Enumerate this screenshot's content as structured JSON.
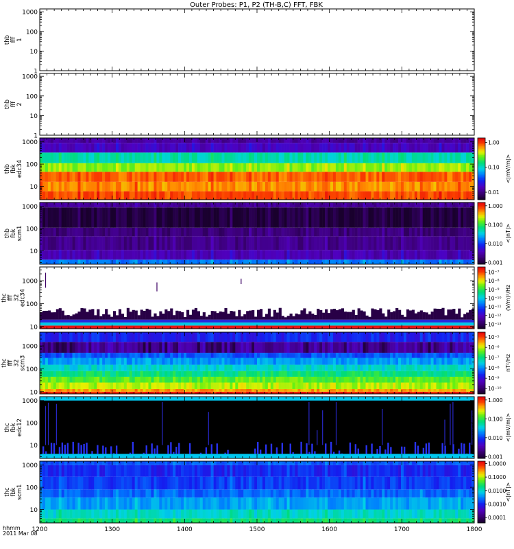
{
  "chart_data": {
    "type": "heatmap",
    "title": "Outer Probes: P1, P2 (TH-B,C) FFT, FBK",
    "x_axis": {
      "label_line1": "hhmm",
      "label_line2": "2011 Mar 08",
      "range": [
        1200,
        1800
      ],
      "tick_labels": [
        "1200",
        "1300",
        "1400",
        "1500",
        "1600",
        "1700",
        "1800"
      ],
      "tick_values": [
        1200,
        1300,
        1400,
        1500,
        1600,
        1700,
        1800
      ]
    },
    "panels": [
      {
        "ylabel": [
          "thb",
          "fff",
          "1"
        ],
        "ylog": true,
        "yrange": [
          1,
          1400
        ],
        "y_tick_labels": [
          "1",
          "10",
          "100",
          "1000"
        ],
        "y_tick_values": [
          1,
          10,
          100,
          1000
        ],
        "colorbar": null,
        "pattern": "empty"
      },
      {
        "ylabel": [
          "thb",
          "fff",
          "2"
        ],
        "ylog": true,
        "yrange": [
          1,
          1400
        ],
        "y_tick_labels": [
          "1",
          "10",
          "100",
          "1000"
        ],
        "y_tick_values": [
          1,
          10,
          100,
          1000
        ],
        "colorbar": null,
        "pattern": "empty"
      },
      {
        "ylabel": [
          "thb",
          "fbk",
          "edc34"
        ],
        "ylog": true,
        "yrange": [
          2.5,
          1500
        ],
        "y_tick_labels": [
          "10",
          "100",
          "1000"
        ],
        "y_tick_values": [
          10,
          100,
          1000
        ],
        "colorbar": {
          "label": "<|mV/m|>",
          "ticks": [
            "1.00",
            "0.10",
            "0.01"
          ],
          "tick_values": [
            1.0,
            0.1,
            0.01
          ],
          "range": [
            0.005,
            1.5
          ],
          "log": true
        },
        "pattern": "bands",
        "bands": [
          {
            "f": [
              2.5,
              6
            ],
            "level": 0.92
          },
          {
            "f": [
              6,
              16
            ],
            "level": 0.86
          },
          {
            "f": [
              16,
              45
            ],
            "level": 0.9
          },
          {
            "f": [
              45,
              110
            ],
            "level": 0.72
          },
          {
            "f": [
              110,
              330
            ],
            "level": 0.55
          },
          {
            "f": [
              330,
              900
            ],
            "level": 0.2
          },
          {
            "f": [
              900,
              1500
            ],
            "level": 0.15
          }
        ]
      },
      {
        "ylabel": [
          "thb",
          "fbk",
          "scm1"
        ],
        "ylog": true,
        "yrange": [
          2.5,
          1500
        ],
        "y_tick_labels": [
          "10",
          "100",
          "1000"
        ],
        "y_tick_values": [
          10,
          100,
          1000
        ],
        "colorbar": {
          "label": "<|nT|>",
          "ticks": [
            "1.000",
            "0.100",
            "0.010",
            "0.001"
          ],
          "tick_values": [
            1.0,
            0.1,
            0.01,
            0.001
          ],
          "range": [
            0.0008,
            1.5
          ],
          "log": true
        },
        "pattern": "bands",
        "bands": [
          {
            "f": [
              2.5,
              4
            ],
            "level": 0.4
          },
          {
            "f": [
              4,
              11
            ],
            "level": 0.18
          },
          {
            "f": [
              11,
              45
            ],
            "level": 0.12
          },
          {
            "f": [
              45,
              110
            ],
            "level": 0.1
          },
          {
            "f": [
              110,
              900
            ],
            "level": 0.02
          },
          {
            "f": [
              900,
              1500
            ],
            "level": 0.14
          }
        ]
      },
      {
        "ylabel": [
          "thc",
          "fff",
          "32",
          "edc34"
        ],
        "ylog": true,
        "yrange": [
          8,
          4000
        ],
        "y_tick_labels": [
          "10",
          "100",
          "1000"
        ],
        "y_tick_values": [
          10,
          100,
          1000
        ],
        "colorbar": {
          "label": "(V/m)²/Hz",
          "ticks": [
            "10⁻⁷",
            "10⁻⁸",
            "10⁻⁹",
            "10⁻¹⁰",
            "10⁻¹¹",
            "10⁻¹²",
            "10⁻¹³"
          ],
          "tick_values": [
            1e-07,
            1e-08,
            1e-09,
            1e-10,
            1e-11,
            1e-12,
            1e-13
          ],
          "range": [
            3e-14,
            4e-07
          ],
          "log": true
        },
        "pattern": "sparse"
      },
      {
        "ylabel": [
          "thc",
          "fff",
          "32",
          "scm3"
        ],
        "ylog": true,
        "yrange": [
          8,
          4000
        ],
        "y_tick_labels": [
          "10",
          "100",
          "1000"
        ],
        "y_tick_values": [
          10,
          100,
          1000
        ],
        "colorbar": {
          "label": "nT²/Hz",
          "ticks": [
            "10⁻⁵",
            "10⁻⁶",
            "10⁻⁷",
            "10⁻⁸",
            "10⁻⁹",
            "10⁻¹⁰"
          ],
          "tick_values": [
            1e-05,
            1e-06,
            1e-07,
            1e-08,
            1e-09,
            1e-10
          ],
          "range": [
            3e-11,
            3e-05
          ],
          "log": true
        },
        "pattern": "gradient"
      },
      {
        "ylabel": [
          "thc",
          "fbk",
          "edc12"
        ],
        "ylog": true,
        "yrange": [
          2.5,
          1500
        ],
        "y_tick_labels": [
          "10",
          "100",
          "1000"
        ],
        "y_tick_values": [
          10,
          100,
          1000
        ],
        "colorbar": {
          "label": "<|mV/m|>",
          "ticks": [
            "1.000",
            "0.100",
            "0.010",
            "0.001"
          ],
          "tick_values": [
            1.0,
            0.1,
            0.01,
            0.001
          ],
          "range": [
            0.0008,
            1.5
          ],
          "log": true
        },
        "pattern": "dark"
      },
      {
        "ylabel": [
          "thc",
          "fbk",
          "scm1"
        ],
        "ylog": true,
        "yrange": [
          2.5,
          1500
        ],
        "y_tick_labels": [
          "10",
          "100",
          "1000"
        ],
        "y_tick_values": [
          10,
          100,
          1000
        ],
        "colorbar": {
          "label": "<|nT|>",
          "ticks": [
            "1.0000",
            "0.1000",
            "0.0100",
            "0.0010",
            "0.0001"
          ],
          "tick_values": [
            1.0,
            0.1,
            0.01,
            0.001,
            0.0001
          ],
          "range": [
            4e-05,
            1.5
          ],
          "log": true
        },
        "pattern": "bands",
        "bands": [
          {
            "f": [
              2.5,
              4
            ],
            "level": 0.6
          },
          {
            "f": [
              4,
              10
            ],
            "level": 0.52
          },
          {
            "f": [
              10,
              35
            ],
            "level": 0.44
          },
          {
            "f": [
              35,
              80
            ],
            "level": 0.38
          },
          {
            "f": [
              80,
              300
            ],
            "level": 0.33
          },
          {
            "f": [
              300,
              1000
            ],
            "level": 0.3
          },
          {
            "f": [
              1000,
              1500
            ],
            "level": 0.36
          }
        ]
      }
    ]
  }
}
